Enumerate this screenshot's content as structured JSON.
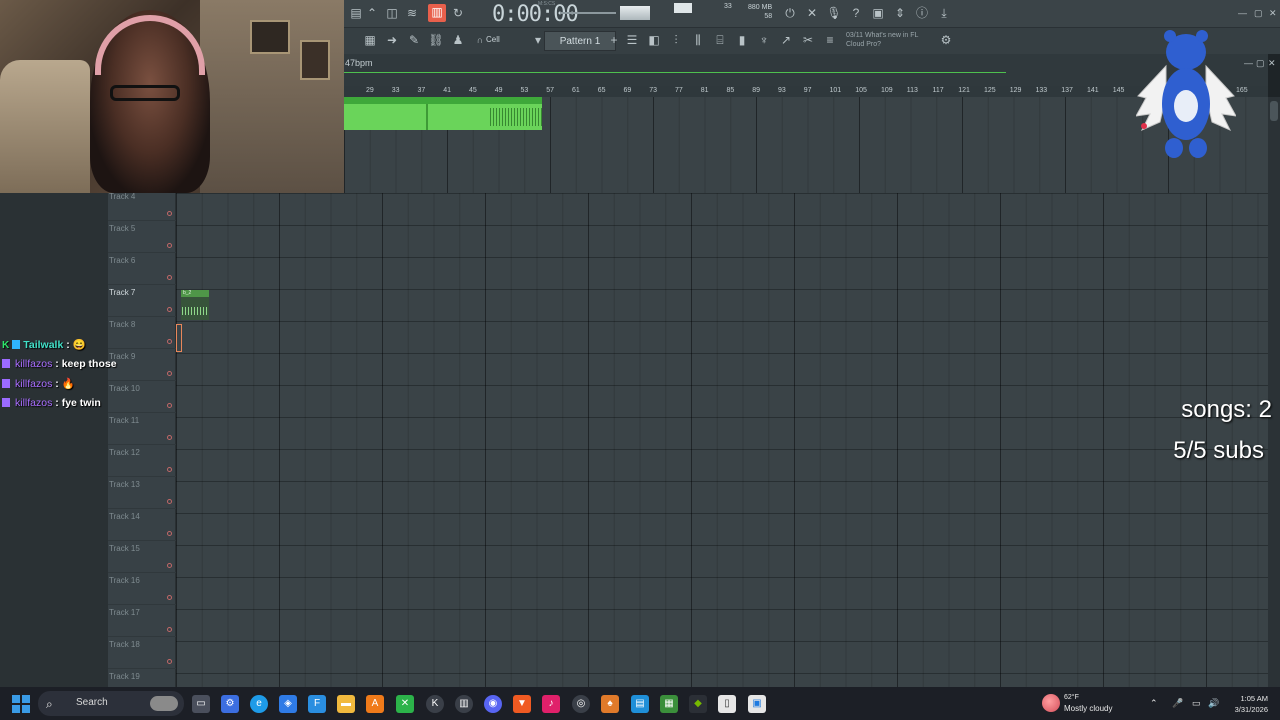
{
  "toolbar": {
    "time": "0:00:00",
    "time_label": "M:S:CS",
    "cpu": "33",
    "memory": "880 MB",
    "polyphony": "58",
    "snap": "Cell",
    "pattern": "Pattern 1",
    "news_line1": "03/11  What's new in FL",
    "news_line2": "Cloud Pro?"
  },
  "playlist": {
    "tempo": "47bpm",
    "ruler_ticks": [
      "29",
      "33",
      "37",
      "41",
      "45",
      "49",
      "53",
      "57",
      "61",
      "65",
      "69",
      "73",
      "77",
      "81",
      "85",
      "89",
      "93",
      "97",
      "101",
      "105",
      "109",
      "113",
      "117",
      "121",
      "125",
      "129",
      "133",
      "137",
      "141",
      "145",
      "165"
    ],
    "tracks": [
      "Track 4",
      "Track 5",
      "Track 6",
      "Track 7",
      "Track 8",
      "Track 9",
      "Track 10",
      "Track 11",
      "Track 12",
      "Track 13",
      "Track 14",
      "Track 15",
      "Track 16",
      "Track 17",
      "Track 18",
      "Track 19"
    ],
    "clip_label": "b_2"
  },
  "chat": [
    {
      "user": "Tailwalk",
      "msg": "",
      "emote": "😄"
    },
    {
      "user": "killfazos",
      "msg": "keep those",
      "emote": ""
    },
    {
      "user": "killfazos",
      "msg": "",
      "emote": "🔥"
    },
    {
      "user": "killfazos",
      "msg": "fye twin",
      "emote": ""
    }
  ],
  "overlay": {
    "songs": "songs: 2",
    "subs": "5/5 subs"
  },
  "taskbar": {
    "search_label": "Search",
    "weather_temp": "62°F",
    "weather_cond": "Mostly cloudy",
    "time": "1:05 AM",
    "date": "3/31/2026"
  },
  "colors": {
    "clip_green": "#6ad45a",
    "record_orange": "#e8604c",
    "chat_purple": "#a86cff",
    "chat_teal": "#41e0c8"
  }
}
